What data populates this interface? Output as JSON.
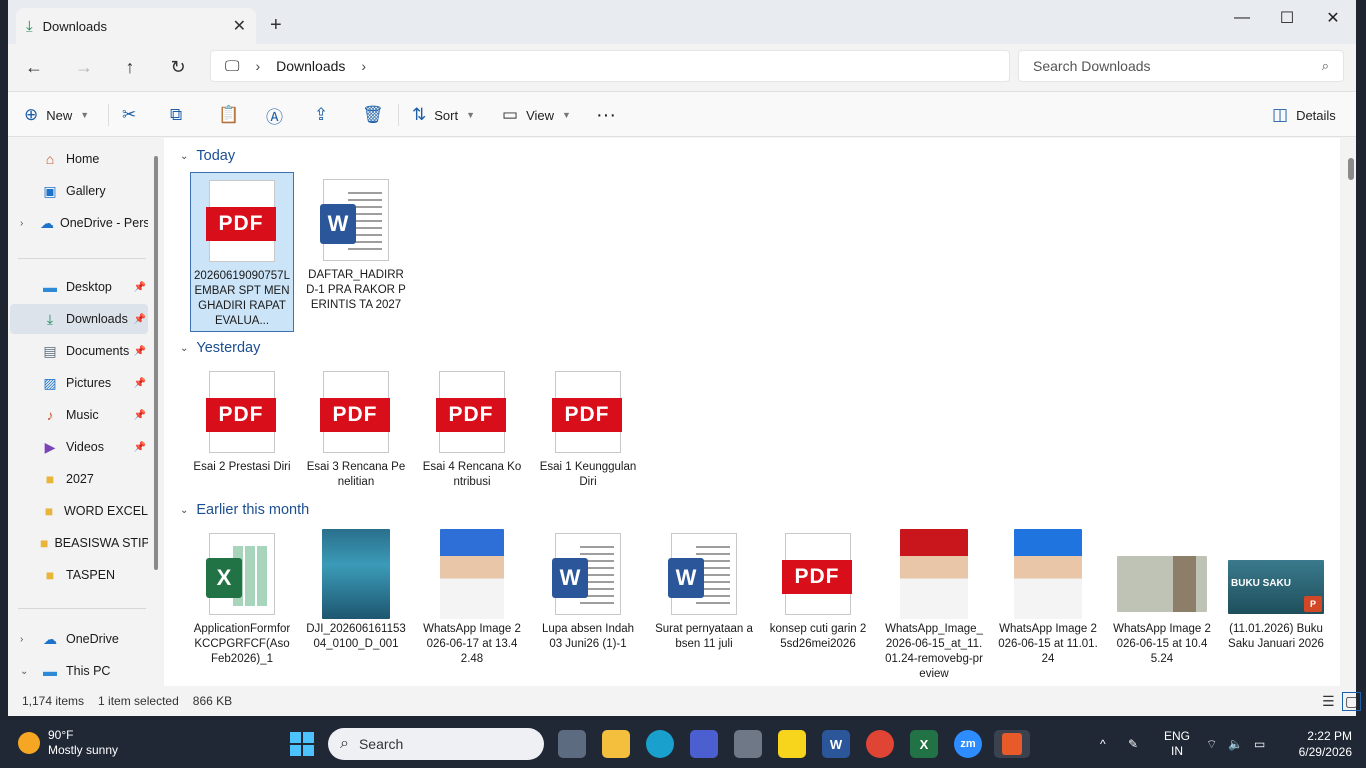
{
  "window": {
    "tab_title": "Downloads",
    "new_tab": "+",
    "minimize": "—",
    "maximize": "☐",
    "close": "✕"
  },
  "address": {
    "breadcrumb": [
      "Downloads"
    ],
    "search_placeholder": "Search Downloads"
  },
  "toolbar": {
    "new_label": "New",
    "sort_label": "Sort",
    "view_label": "View",
    "more_label": "···",
    "details_label": "Details"
  },
  "sidebar": {
    "items": [
      {
        "label": "Home",
        "icon": "home-icon"
      },
      {
        "label": "Gallery",
        "icon": "gallery-icon"
      },
      {
        "label": "OneDrive - Personal",
        "icon": "onedrive-icon"
      },
      {
        "label": "Desktop",
        "icon": "desktop-icon"
      },
      {
        "label": "Downloads",
        "icon": "downloads-icon"
      },
      {
        "label": "Documents",
        "icon": "documents-icon"
      },
      {
        "label": "Pictures",
        "icon": "pictures-icon"
      },
      {
        "label": "Music",
        "icon": "music-icon"
      },
      {
        "label": "Videos",
        "icon": "videos-icon"
      },
      {
        "label": "2027",
        "icon": "folder-icon"
      },
      {
        "label": "WORD EXCEL",
        "icon": "folder-icon"
      },
      {
        "label": "BEASISWA STIP",
        "icon": "folder-icon"
      },
      {
        "label": "TASPEN",
        "icon": "folder-icon"
      },
      {
        "label": "OneDrive",
        "icon": "onedrive-icon"
      },
      {
        "label": "This PC",
        "icon": "pc-icon"
      }
    ]
  },
  "groups": [
    {
      "title": "Today",
      "files": [
        {
          "name": "20260619090757LEMBAR SPT MENGHADIRI RAPAT EVALUA...",
          "type": "pdf"
        },
        {
          "name": "DAFTAR_HADIRRD-1 PRA RAKOR PERINTIS TA 2027",
          "type": "word"
        }
      ]
    },
    {
      "title": "Yesterday",
      "files": [
        {
          "name": "Esai 2 Prestasi Diri",
          "type": "pdf"
        },
        {
          "name": "Esai 3 Rencana Penelitian",
          "type": "pdf"
        },
        {
          "name": "Esai 4 Rencana Kontribusi",
          "type": "pdf"
        },
        {
          "name": "Esai 1 Keunggulan Diri",
          "type": "pdf"
        }
      ]
    },
    {
      "title": "Earlier this month",
      "files": [
        {
          "name": "ApplicationFormforKCCPGRFCF(AsoFeb2026)_1",
          "type": "excel"
        },
        {
          "name": "DJI_20260616115304_0100_D_001",
          "type": "photo-pool"
        },
        {
          "name": "WhatsApp Image 2026-06-17 at 13.42.48",
          "type": "photo-blue"
        },
        {
          "name": "Lupa absen Indah 03 Juni26 (1)-1",
          "type": "word"
        },
        {
          "name": "Surat pernyataan absen 11 juli",
          "type": "word"
        },
        {
          "name": "konsep cuti garin 25sd26mei2026",
          "type": "pdf"
        },
        {
          "name": "WhatsApp_Image_2026-06-15_at_11.01.24-removebg-preview",
          "type": "photo-red"
        },
        {
          "name": "WhatsApp Image 2026-06-15 at 11.01.24",
          "type": "photo-blue2"
        },
        {
          "name": "WhatsApp Image 2026-06-15 at 10.45.24",
          "type": "photo-card"
        },
        {
          "name": "(11.01.2026) Buku Saku Januari 2026",
          "type": "photo-book"
        }
      ]
    }
  ],
  "badges": {
    "pdf": "PDF",
    "word": "W",
    "excel": "X",
    "book": "BUKU SAKU"
  },
  "status": {
    "items": "1,174 items",
    "selected": "1 item selected",
    "size": "866 KB"
  },
  "taskbar": {
    "temp": "90°F",
    "weather": "Mostly sunny",
    "search": "Search",
    "lang1": "ENG",
    "lang2": "IN",
    "time": "2:22 PM",
    "date": "6/29/2026",
    "zoom_label": "zm"
  },
  "colors": {
    "accent": "#1c4f92",
    "pdf_red": "#d80e1a",
    "word_blue": "#2b579a",
    "excel_green": "#217346",
    "selection": "#cce4f7"
  }
}
